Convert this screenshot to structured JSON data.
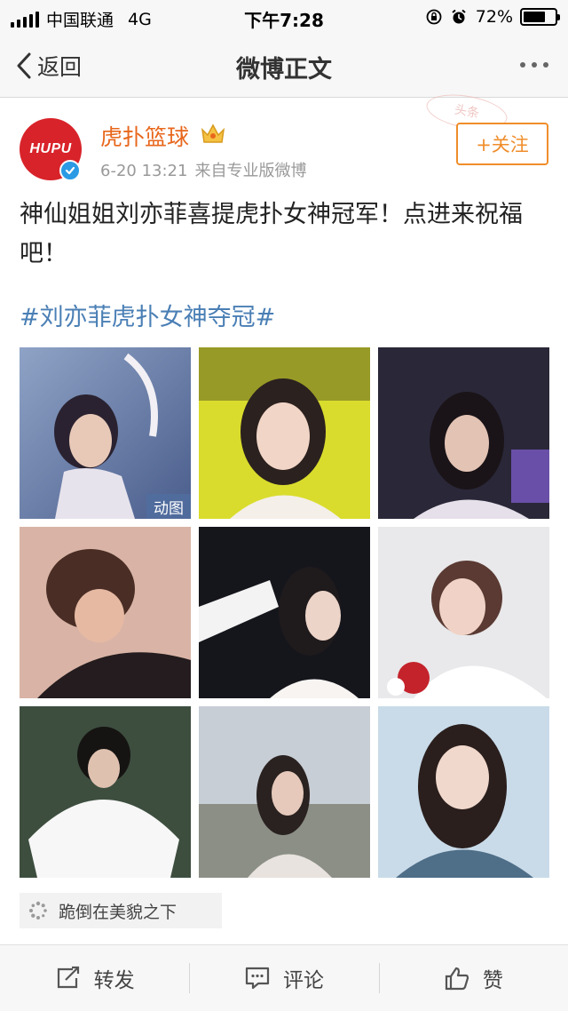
{
  "status_bar": {
    "carrier": "中国联通",
    "network": "4G",
    "time": "下午7:28",
    "battery_text": "72%",
    "battery_level": 0.72
  },
  "nav": {
    "back_label": "返回",
    "title": "微博正文"
  },
  "post": {
    "avatar_text": "HUPU",
    "username": "虎扑篮球",
    "date": "6-20 13:21",
    "source": "来自专业版微博",
    "follow_label": "+关注",
    "stamp_text": "头条",
    "text": "神仙姐姐刘亦菲喜提虎扑女神冠军！点进来祝福吧！",
    "hashtag": "#刘亦菲虎扑女神夺冠#",
    "gif_badge": "动图",
    "reaction_tag": "跪倒在美貌之下"
  },
  "actions": {
    "repost": "转发",
    "comment": "评论",
    "like": "赞"
  },
  "colors": {
    "username": "#e8671c",
    "follow": "#f08d2a",
    "hashtag": "#4a7fb5",
    "avatar_bg": "#d8232a",
    "verified": "#2a9ae4"
  }
}
